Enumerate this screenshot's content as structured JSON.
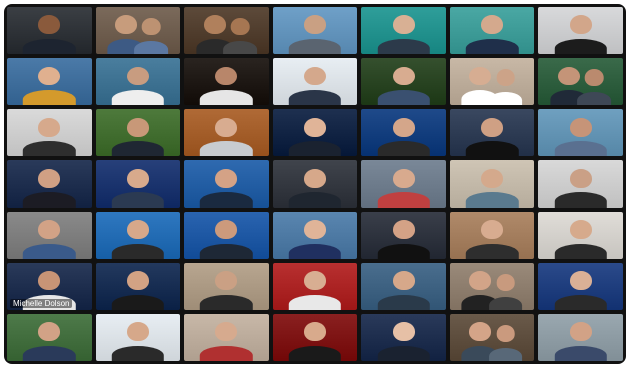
{
  "meeting": {
    "participants": [
      {
        "bg": "#3b3f44",
        "skin": "#8a5a3c",
        "shirt": "#1d2430",
        "label": "",
        "people": 1
      },
      {
        "bg": "#7b6a5b",
        "skin": "#c79c7c",
        "shirt": "#3d5a84",
        "label": "",
        "people": 2
      },
      {
        "bg": "#5d4a3a",
        "skin": "#b0805c",
        "shirt": "#2a2a2a",
        "label": "",
        "people": 2
      },
      {
        "bg": "#6fa0c8",
        "skin": "#c9a083",
        "shirt": "#5a6470",
        "label": "",
        "people": 1
      },
      {
        "bg": "#2f9e9a",
        "skin": "#d8b094",
        "shirt": "#2c3a4a",
        "label": "",
        "people": 1
      },
      {
        "bg": "#4aa8a4",
        "skin": "#d4a98d",
        "shirt": "#1f2f4a",
        "label": "",
        "people": 1
      },
      {
        "bg": "#d8d9db",
        "skin": "#d2a68a",
        "shirt": "#1c1c1c",
        "label": "",
        "people": 1
      },
      {
        "bg": "#4b7aa8",
        "skin": "#e0b08f",
        "shirt": "#d49a2c",
        "label": "",
        "people": 1
      },
      {
        "bg": "#4a7e9e",
        "skin": "#c89c80",
        "shirt": "#eeeeee",
        "label": "",
        "people": 1
      },
      {
        "bg": "#2a2420",
        "skin": "#b8866a",
        "shirt": "#e6e6e6",
        "label": "",
        "people": 1
      },
      {
        "bg": "#e8eef3",
        "skin": "#d4a88c",
        "shirt": "#2a3548",
        "label": "",
        "people": 1
      },
      {
        "bg": "#35502e",
        "skin": "#d8ac90",
        "shirt": "#3a5070",
        "label": "",
        "people": 1
      },
      {
        "bg": "#c8b8a6",
        "skin": "#d6ad92",
        "shirt": "#ffffff",
        "label": "",
        "people": 2
      },
      {
        "bg": "#3a6a4a",
        "skin": "#c49478",
        "shirt": "#202a38",
        "label": "",
        "people": 2
      },
      {
        "bg": "#dadada",
        "skin": "#d6a98c",
        "shirt": "#2e2e2e",
        "label": "",
        "people": 1
      },
      {
        "bg": "#4e7a3c",
        "skin": "#c89878",
        "shirt": "#1f2733",
        "label": "",
        "people": 1
      },
      {
        "bg": "#b06a36",
        "skin": "#d8ac90",
        "shirt": "#c8ccd0",
        "label": "",
        "people": 1
      },
      {
        "bg": "#1e3050",
        "skin": "#e0b498",
        "shirt": "#1a2230",
        "label": "",
        "people": 1
      },
      {
        "bg": "#1f4a8a",
        "skin": "#d4a68a",
        "shirt": "#2a2a2a",
        "label": "",
        "people": 1
      },
      {
        "bg": "#3a4860",
        "skin": "#cfa084",
        "shirt": "#111111",
        "label": "",
        "people": 1
      },
      {
        "bg": "#6fa0c0",
        "skin": "#c69478",
        "shirt": "#5a7090",
        "label": "",
        "people": 1
      },
      {
        "bg": "#2a3a5a",
        "skin": "#d0a084",
        "shirt": "#1c1c24",
        "label": "",
        "people": 1
      },
      {
        "bg": "#27407a",
        "skin": "#d8aa8c",
        "shirt": "#2b3a52",
        "label": "",
        "people": 1
      },
      {
        "bg": "#2f6ab0",
        "skin": "#d4a286",
        "shirt": "#1a2a40",
        "label": "",
        "people": 1
      },
      {
        "bg": "#40444c",
        "skin": "#d6a88a",
        "shirt": "#1f2630",
        "label": "",
        "people": 1
      },
      {
        "bg": "#7a8898",
        "skin": "#d8aa8e",
        "shirt": "#c04040",
        "label": "",
        "people": 1
      },
      {
        "bg": "#cfc5b5",
        "skin": "#d4a98c",
        "shirt": "#5a7a8e",
        "label": "",
        "people": 1
      },
      {
        "bg": "#d9d9d9",
        "skin": "#caa086",
        "shirt": "#2a2a2a",
        "label": "",
        "people": 1
      },
      {
        "bg": "#8a8a8a",
        "skin": "#d2a286",
        "shirt": "#3a5a8a",
        "label": "",
        "people": 1
      },
      {
        "bg": "#2f78c0",
        "skin": "#d6a88a",
        "shirt": "#2a2a2a",
        "label": "",
        "people": 1
      },
      {
        "bg": "#2a64b0",
        "skin": "#cc9a7c",
        "shirt": "#1e2836",
        "label": "",
        "people": 1
      },
      {
        "bg": "#5a86b0",
        "skin": "#e0b498",
        "shirt": "#203060",
        "label": "",
        "people": 1
      },
      {
        "bg": "#3a3f4a",
        "skin": "#d4a286",
        "shirt": "#111111",
        "label": "",
        "people": 1
      },
      {
        "bg": "#b08a6a",
        "skin": "#d8ac90",
        "shirt": "#2e2e2e",
        "label": "",
        "people": 1
      },
      {
        "bg": "#e0ddd8",
        "skin": "#d6aa8c",
        "shirt": "#2a2a2a",
        "label": "",
        "people": 1
      },
      {
        "bg": "#2a3a5a",
        "skin": "#c89476",
        "shirt": "#e6e6e6",
        "label": "Michelle Dolson",
        "people": 1
      },
      {
        "bg": "#23395e",
        "skin": "#d2a284",
        "shirt": "#1a1a1a",
        "label": "",
        "people": 1
      },
      {
        "bg": "#b8a690",
        "skin": "#caa084",
        "shirt": "#2a2a2a",
        "label": "",
        "people": 1
      },
      {
        "bg": "#b83030",
        "skin": "#d8ae92",
        "shirt": "#e8e8e8",
        "label": "",
        "people": 1
      },
      {
        "bg": "#4a6e8e",
        "skin": "#d6a88a",
        "shirt": "#2a3a4a",
        "label": "",
        "people": 1
      },
      {
        "bg": "#9a8a7a",
        "skin": "#d2a488",
        "shirt": "#222222",
        "label": "",
        "people": 2
      },
      {
        "bg": "#2b4a8a",
        "skin": "#dab096",
        "shirt": "#2a2a2a",
        "label": "",
        "people": 1
      },
      {
        "bg": "#4e7a4a",
        "skin": "#d2a286",
        "shirt": "#2a3a5a",
        "label": "",
        "people": 1
      },
      {
        "bg": "#e8eef3",
        "skin": "#d6a88a",
        "shirt": "#2a2a2a",
        "label": "",
        "people": 1
      },
      {
        "bg": "#c8b8a8",
        "skin": "#d6aa8e",
        "shirt": "#b03030",
        "label": "",
        "people": 1
      },
      {
        "bg": "#8a2020",
        "skin": "#d8aa8c",
        "shirt": "#1a1a1a",
        "label": "",
        "people": 1
      },
      {
        "bg": "#2a3a5a",
        "skin": "#e6c0a6",
        "shirt": "#1a2230",
        "label": "",
        "people": 1
      },
      {
        "bg": "#6a5a4a",
        "skin": "#d4a488",
        "shirt": "#3a4a5a",
        "label": "",
        "people": 2
      },
      {
        "bg": "#9aa8b0",
        "skin": "#d2a286",
        "shirt": "#3a4a6a",
        "label": "",
        "people": 1
      }
    ]
  }
}
